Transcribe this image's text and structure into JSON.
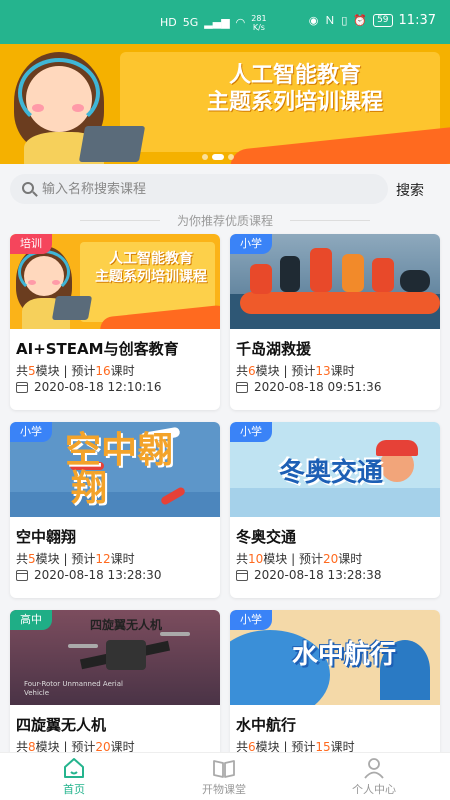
{
  "status_bar": {
    "time": "11:37",
    "network": "HD",
    "signal": "5G",
    "speed_value": "281",
    "speed_unit": "K/s",
    "battery": "59"
  },
  "banner": {
    "title_line1": "人工智能教育",
    "title_line2": "主题系列培训课程",
    "slide_count": 3,
    "active_slide": 1
  },
  "search": {
    "placeholder": "输入名称搜索课程",
    "button": "搜索"
  },
  "section_title": "为你推荐优质课程",
  "courses": [
    {
      "tag": "培训",
      "tag_color": "#f5455c",
      "thumb_line1": "人工智能教育",
      "thumb_line2": "主题系列培训课程",
      "name": "AI+STEAM与创客教育",
      "modules": "5",
      "hours": "16",
      "date": "2020-08-18 12:10:16"
    },
    {
      "tag": "小学",
      "tag_color": "#3a83f7",
      "thumb_line1": "",
      "thumb_line2": "",
      "name": "千岛湖救援",
      "modules": "6",
      "hours": "13",
      "date": "2020-08-18 09:51:36"
    },
    {
      "tag": "小学",
      "tag_color": "#3a83f7",
      "thumb_line1": "空中翱",
      "thumb_line2": "翔",
      "name": "空中翱翔",
      "modules": "5",
      "hours": "12",
      "date": "2020-08-18 13:28:30"
    },
    {
      "tag": "小学",
      "tag_color": "#3a83f7",
      "thumb_line1": "冬奥交通",
      "thumb_line2": "",
      "name": "冬奥交通",
      "modules": "10",
      "hours": "20",
      "date": "2020-08-18 13:28:38"
    },
    {
      "tag": "高中",
      "tag_color": "#1fae86",
      "thumb_line1": "四旋翼无人机",
      "thumb_line2": "Four-Rotor Unmanned Aerial Vehicle",
      "name": "四旋翼无人机",
      "modules": "8",
      "hours": "20",
      "date": ""
    },
    {
      "tag": "小学",
      "tag_color": "#3a83f7",
      "thumb_line1": "水中航行",
      "thumb_line2": "",
      "name": "水中航行",
      "modules": "6",
      "hours": "15",
      "date": ""
    }
  ],
  "labels": {
    "total": "共",
    "module_unit": "模块",
    "separator": " | ",
    "estimate": "预计",
    "hour_unit": "课时"
  },
  "bottom_nav": [
    {
      "label": "首页",
      "active": true
    },
    {
      "label": "开物课堂",
      "active": false
    },
    {
      "label": "个人中心",
      "active": false
    }
  ],
  "colors": {
    "brand": "#25b48e",
    "highlight": "#ff6a1f"
  }
}
